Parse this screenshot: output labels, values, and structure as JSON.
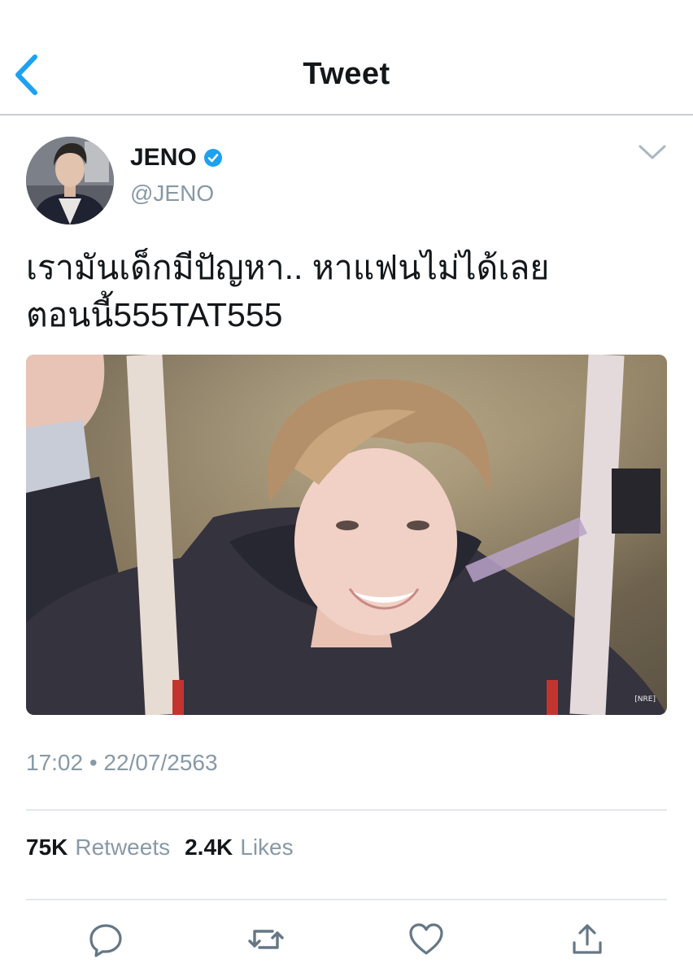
{
  "header": {
    "title": "Tweet",
    "back_icon": "chevron-left-icon"
  },
  "author": {
    "display_name": "JENO",
    "handle": "@JENO",
    "verified": true
  },
  "tweet": {
    "text": "เรามันเด็กมีปัญหา.. หาแฟนไม่ได้เลย\nตอนนี้555TAT555",
    "media_watermark": "[NRE]",
    "timestamp": "17:02 • 22/07/2563"
  },
  "stats": {
    "retweets_count": "75K",
    "retweets_label": "Retweets",
    "likes_count": "2.4K",
    "likes_label": "Likes"
  },
  "actions": [
    "reply-icon",
    "retweet-icon",
    "like-icon",
    "share-icon"
  ],
  "colors": {
    "accent": "#1da1f2",
    "secondary_text": "#8899a6",
    "action_icon": "#657786",
    "divider": "#e1e8ed"
  }
}
